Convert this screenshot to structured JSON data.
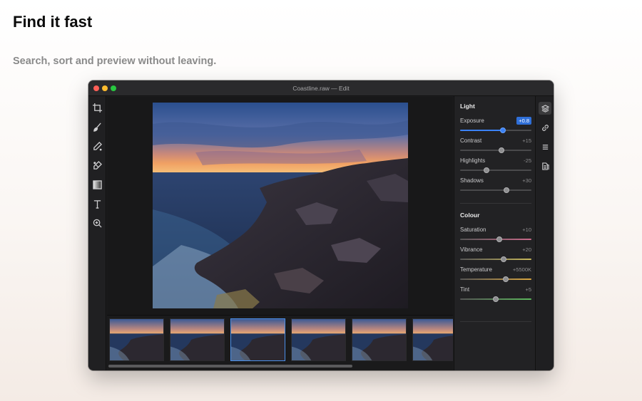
{
  "hero": {
    "title": "Find it fast",
    "subtitle": "Search, sort and preview without leaving."
  },
  "window": {
    "title": "Coastline.raw — Edit"
  },
  "toolbar": {
    "tools": [
      "crop-icon",
      "brush-icon",
      "pen-icon",
      "heal-icon",
      "gradient-icon",
      "text-icon",
      "zoom-icon"
    ]
  },
  "filmstrip": {
    "thumbnail_count": 6,
    "selected_index": 2
  },
  "panel": {
    "light": {
      "title": "Light",
      "sliders": [
        {
          "label": "Exposure",
          "value": "+0.8",
          "level": 0.6,
          "active": true
        },
        {
          "label": "Contrast",
          "value": "+15",
          "level": 0.58,
          "active": false
        },
        {
          "label": "Highlights",
          "value": "-25",
          "level": 0.37,
          "active": false
        },
        {
          "label": "Shadows",
          "value": "+30",
          "level": 0.65,
          "active": false
        }
      ]
    },
    "colour": {
      "title": "Colour",
      "sliders": [
        {
          "label": "Saturation",
          "value": "+10",
          "level": 0.55,
          "track": "#c96a8a"
        },
        {
          "label": "Vibrance",
          "value": "+20",
          "level": 0.61,
          "track": "#c8b85a"
        },
        {
          "label": "Temperature",
          "value": "+5500K",
          "level": 0.64,
          "track": "#d9a640"
        },
        {
          "label": "Tint",
          "value": "+5",
          "level": 0.5,
          "track": "#5cb85c"
        }
      ]
    }
  },
  "rail": {
    "icons": [
      "layers-icon",
      "link-icon",
      "list-icon",
      "document-icon"
    ],
    "active_index": 0
  },
  "colors": {
    "accent": "#3b82f6",
    "window_bg": "#1c1c1e"
  }
}
